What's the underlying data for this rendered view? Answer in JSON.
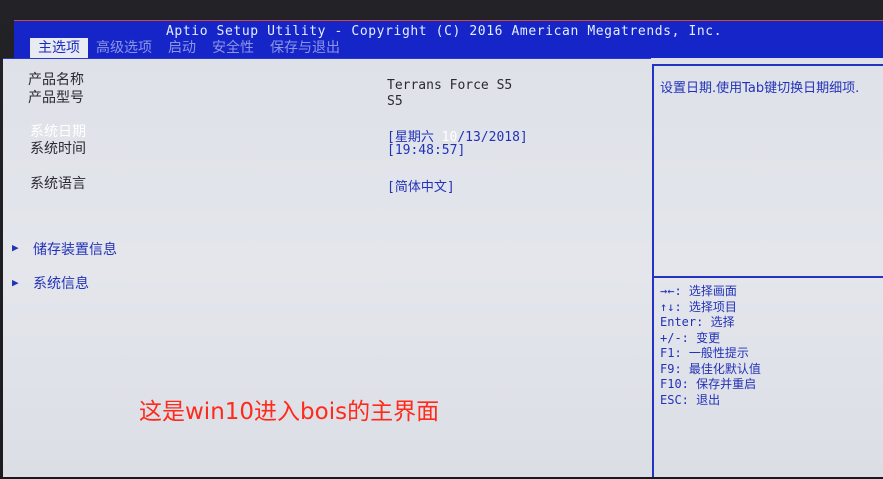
{
  "header": {
    "title": "Aptio Setup Utility - Copyright (C) 2016 American Megatrends, Inc.",
    "tabs": [
      {
        "label": "主选项",
        "active": true
      },
      {
        "label": "高级选项",
        "active": false
      },
      {
        "label": "启动",
        "active": false
      },
      {
        "label": "安全性",
        "active": false
      },
      {
        "label": "保存与退出",
        "active": false
      }
    ]
  },
  "main": {
    "product_name_label": "产品名称",
    "product_name_value": "Terrans Force S5",
    "product_model_label": "产品型号",
    "product_model_value": "S5",
    "system_date_label": "系统日期",
    "system_date_prefix": "[星期六 ",
    "system_date_month_highlight": "10",
    "system_date_rest": "/13/2018]",
    "system_time_label": "系统时间",
    "system_time_value": "[19:48:57]",
    "system_language_label": "系统语言",
    "system_language_value": "[简体中文]",
    "submenus": [
      {
        "label": "储存装置信息"
      },
      {
        "label": "系统信息"
      }
    ]
  },
  "help": {
    "text": "设置日期.使用Tab键切换日期细项.",
    "keys": [
      "→←: 选择画面",
      "↑↓: 选择项目",
      "Enter: 选择",
      "+/-: 变更",
      "F1: 一般性提示",
      "F9: 最佳化默认值",
      "F10: 保存并重启",
      "ESC: 退出"
    ]
  },
  "annotation": {
    "text": "这是win10进入bois的主界面"
  },
  "colors": {
    "header_blue": "#1525c8",
    "screen_bg": "#e2e4ea",
    "accent_blue": "#2232b8",
    "annotation_red": "#ff2a1a"
  }
}
